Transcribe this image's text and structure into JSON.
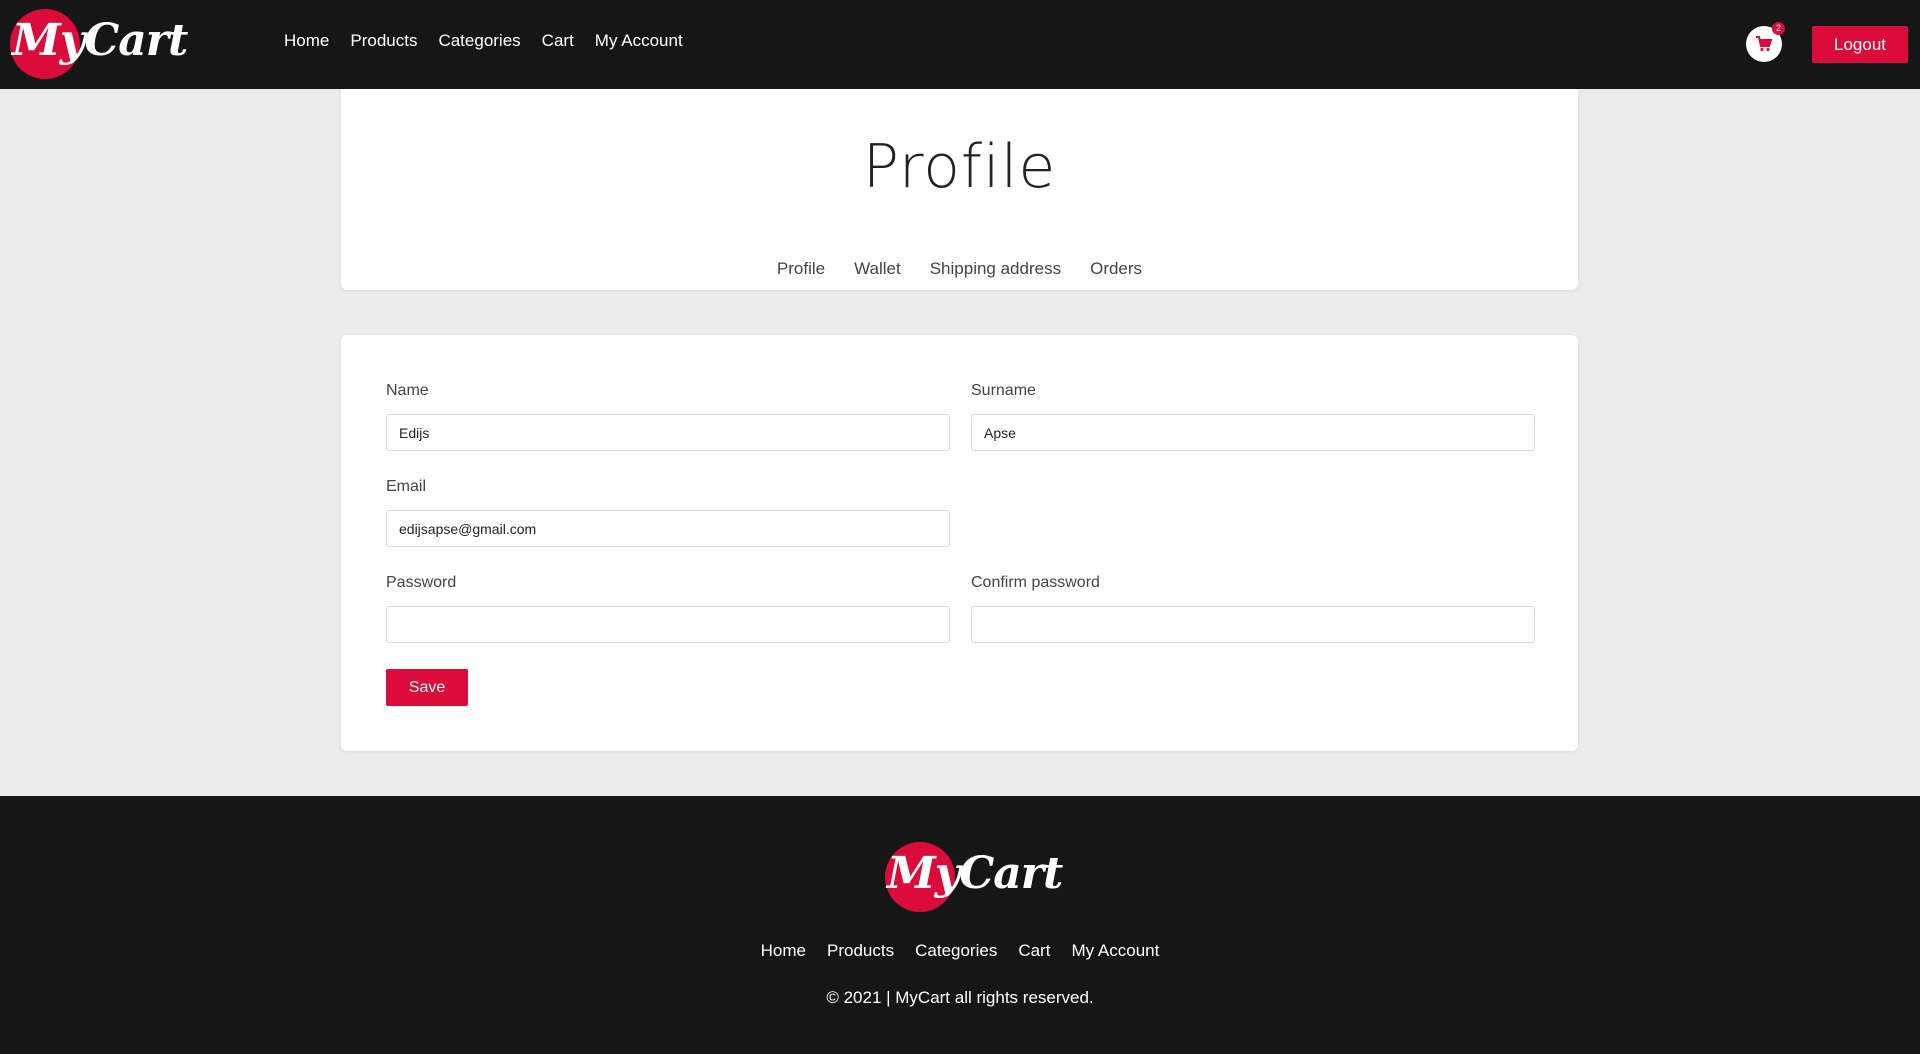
{
  "brand": {
    "name": "MyCart",
    "accent": "#db0b3a",
    "dark": "#161616"
  },
  "header": {
    "nav": [
      "Home",
      "Products",
      "Categories",
      "Cart",
      "My Account"
    ],
    "cart_count": "2",
    "cart_icon": "shopping-cart-icon",
    "logout_label": "Logout"
  },
  "profile": {
    "title": "Profile",
    "tabs": [
      "Profile",
      "Wallet",
      "Shipping address",
      "Orders"
    ]
  },
  "form": {
    "name_label": "Name",
    "name_value": "Edijs",
    "surname_label": "Surname",
    "surname_value": "Apse",
    "email_label": "Email",
    "email_value": "edijsapse@gmail.com",
    "password_label": "Password",
    "password_value": "",
    "confirm_label": "Confirm password",
    "confirm_value": "",
    "save_label": "Save"
  },
  "footer": {
    "nav": [
      "Home",
      "Products",
      "Categories",
      "Cart",
      "My Account"
    ],
    "copyright": "© 2021 | MyCart all rights reserved."
  }
}
